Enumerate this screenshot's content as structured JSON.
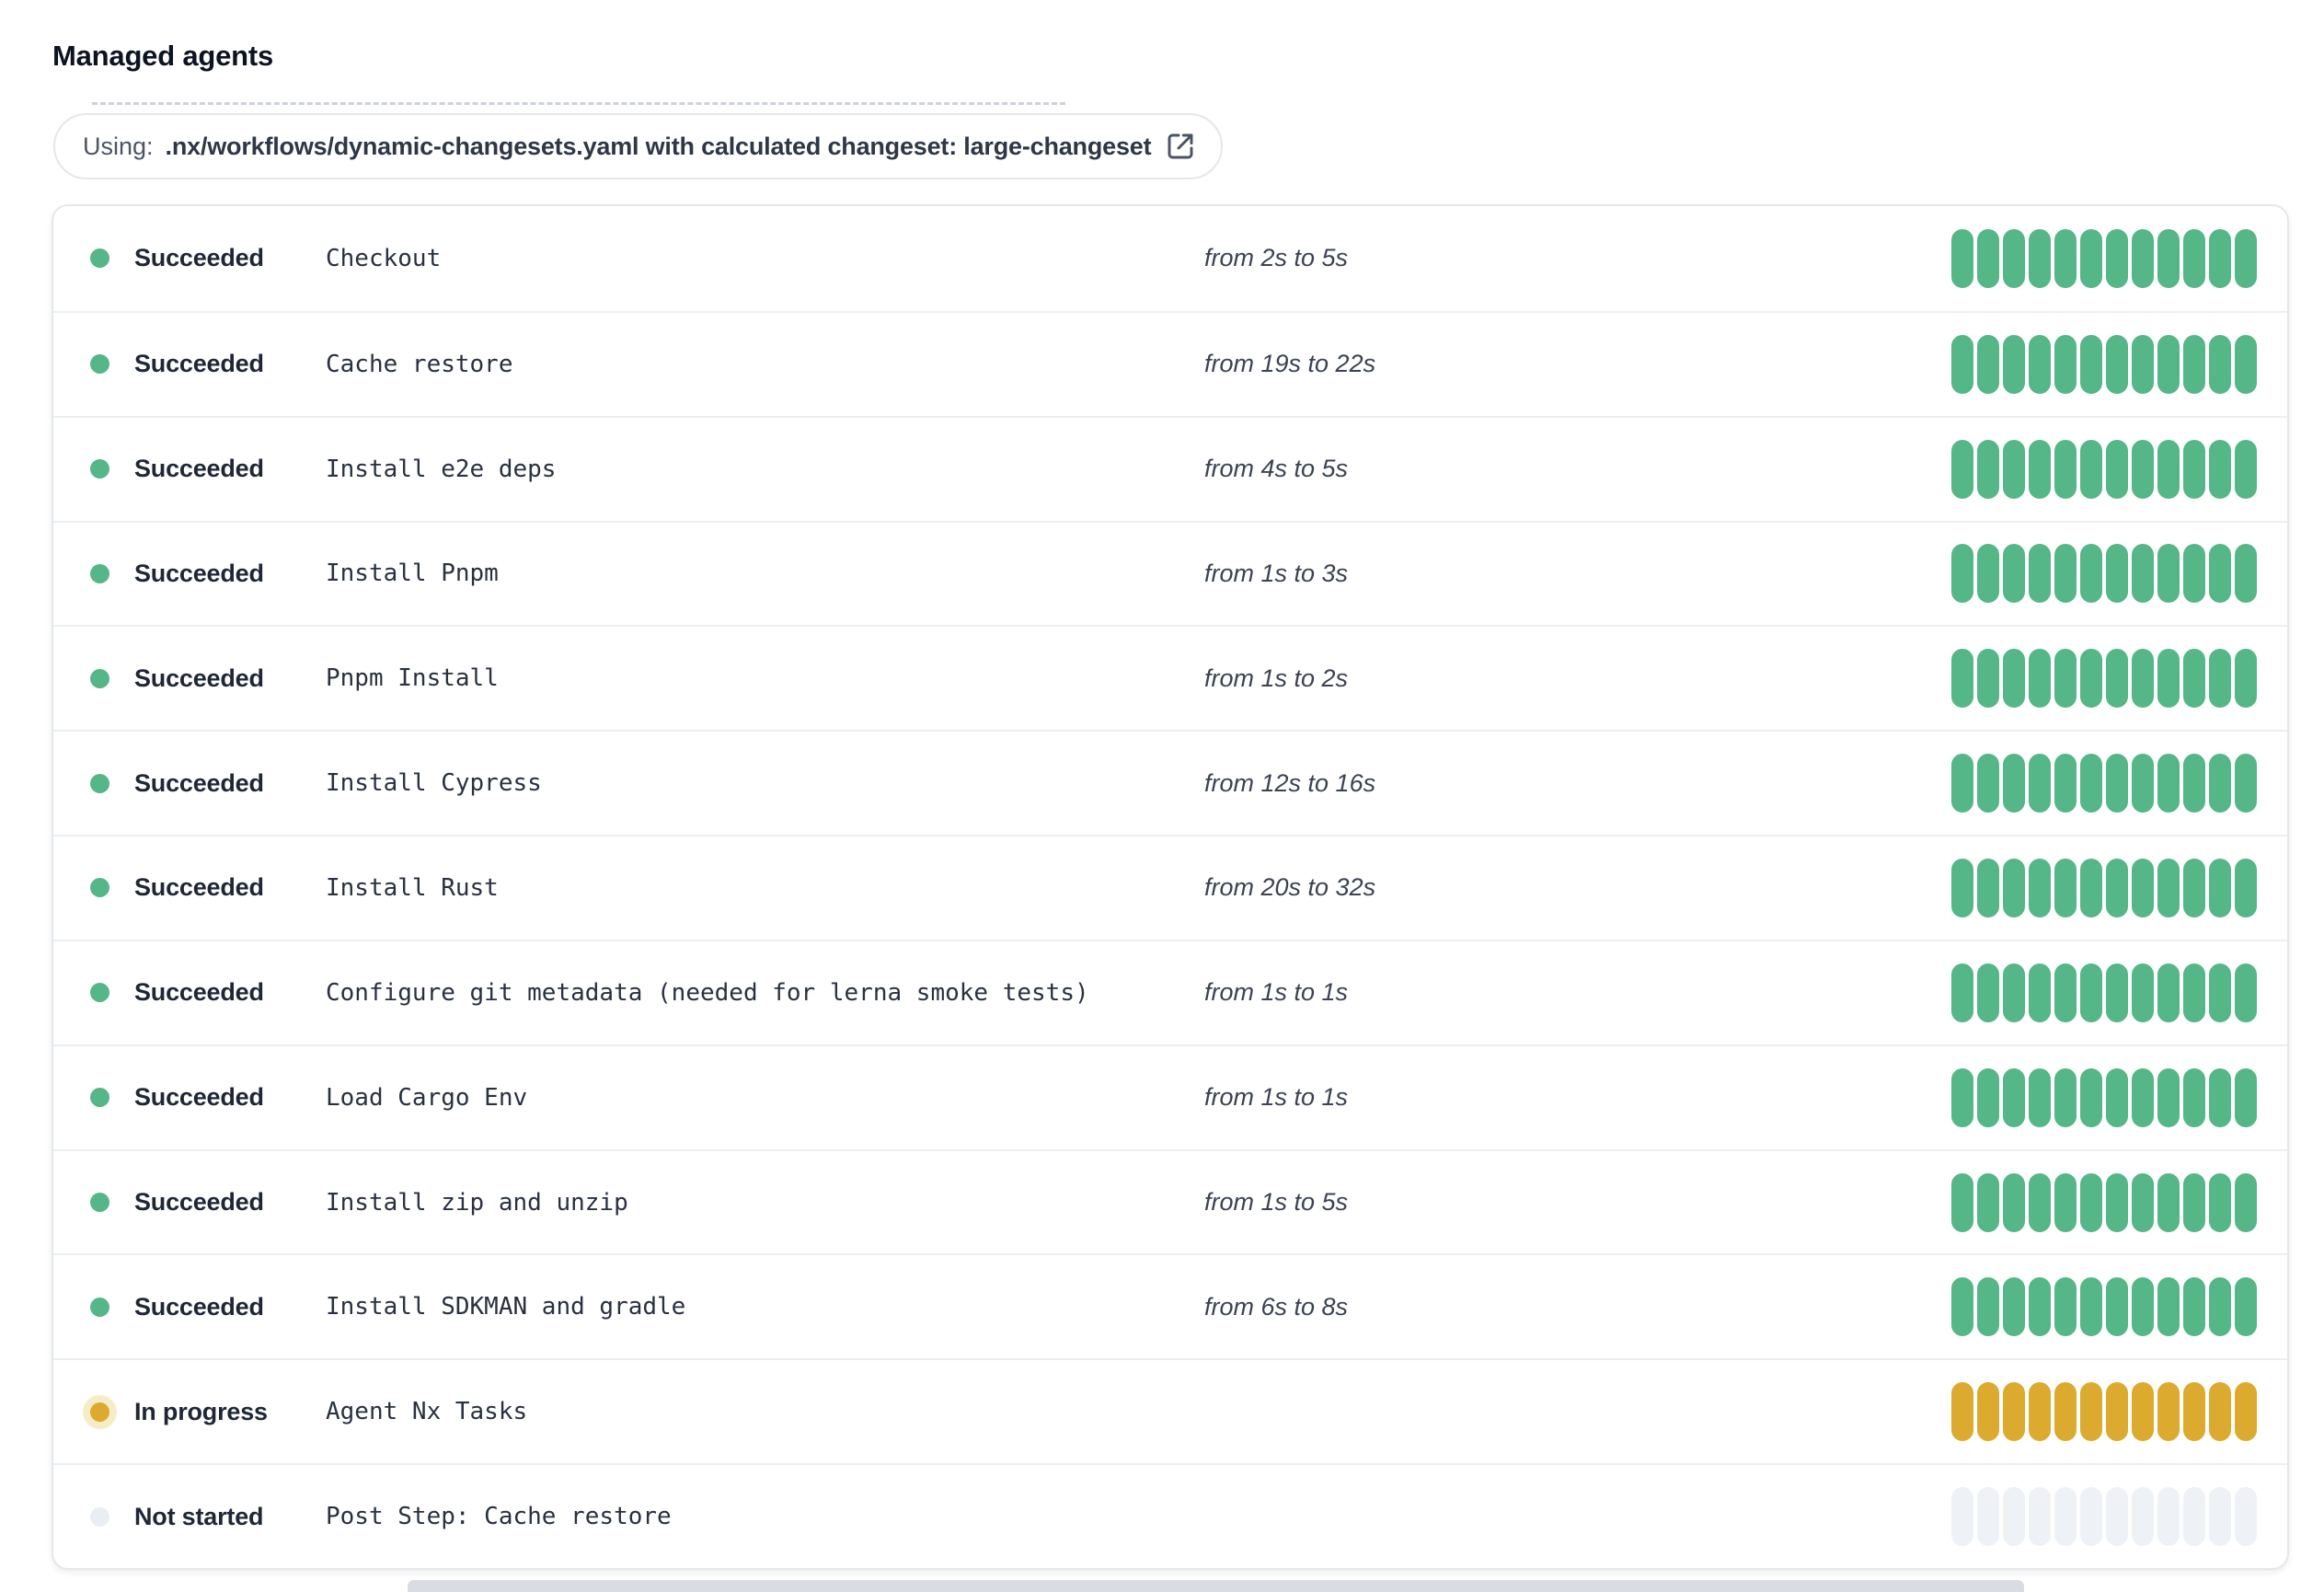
{
  "page": {
    "title": "Managed agents"
  },
  "banner": {
    "prefix": "Using:",
    "detail": ".nx/workflows/dynamic-changesets.yaml with calculated changeset: large-changeset",
    "icon": "external-link-icon"
  },
  "list": {
    "segments_per_row": 12,
    "rows": [
      {
        "status": "Succeeded",
        "status_key": "succeeded",
        "step": "Checkout",
        "duration": "from 2s to 5s"
      },
      {
        "status": "Succeeded",
        "status_key": "succeeded",
        "step": "Cache restore",
        "duration": "from 19s to 22s"
      },
      {
        "status": "Succeeded",
        "status_key": "succeeded",
        "step": "Install e2e deps",
        "duration": "from 4s to 5s"
      },
      {
        "status": "Succeeded",
        "status_key": "succeeded",
        "step": "Install Pnpm",
        "duration": "from 1s to 3s"
      },
      {
        "status": "Succeeded",
        "status_key": "succeeded",
        "step": "Pnpm Install",
        "duration": "from 1s to 2s"
      },
      {
        "status": "Succeeded",
        "status_key": "succeeded",
        "step": "Install Cypress",
        "duration": "from 12s to 16s"
      },
      {
        "status": "Succeeded",
        "status_key": "succeeded",
        "step": "Install Rust",
        "duration": "from 20s to 32s"
      },
      {
        "status": "Succeeded",
        "status_key": "succeeded",
        "step": "Configure git metadata (needed for lerna smoke tests)",
        "duration": "from 1s to 1s"
      },
      {
        "status": "Succeeded",
        "status_key": "succeeded",
        "step": "Load Cargo Env",
        "duration": "from 1s to 1s"
      },
      {
        "status": "Succeeded",
        "status_key": "succeeded",
        "step": "Install zip and unzip",
        "duration": "from 1s to 5s"
      },
      {
        "status": "Succeeded",
        "status_key": "succeeded",
        "step": "Install SDKMAN and gradle",
        "duration": "from 6s to 8s"
      },
      {
        "status": "In progress",
        "status_key": "in_progress",
        "step": "Agent Nx Tasks",
        "duration": ""
      },
      {
        "status": "Not started",
        "status_key": "not_started",
        "step": "Post Step: Cache restore",
        "duration": ""
      }
    ]
  },
  "colors": {
    "succeeded": "#55b687",
    "in_progress": "#dcaa2f",
    "in_progress_halo": "#f6ecc7",
    "not_started": "#e9eef4",
    "not_started_segment": "#eef2f7",
    "text_dark": "#1f2737",
    "card_border": "#e5e7ea"
  }
}
